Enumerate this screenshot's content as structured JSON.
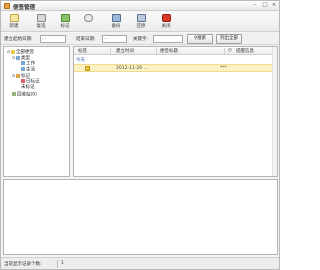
{
  "window": {
    "title": "便签管理"
  },
  "toolbar": {
    "new_label": "新建",
    "delete_label": "复选",
    "mark_label": "标记",
    "search_label": "",
    "backup_label": "备份",
    "restore_label": "还原",
    "close_label": "关闭"
  },
  "filter": {
    "start_date_label": "建立起始日期:",
    "start_date_value": "- -",
    "end_date_label": "结束日期:",
    "end_date_value": "- -",
    "keyword_label": "关键字:",
    "keyword_value": "",
    "search_button": "搜索",
    "list_all_button": "列出全部"
  },
  "tree": {
    "root": "全部便签",
    "category": "类型",
    "work": "工作",
    "life": "生活",
    "mark": "标记",
    "marked": "已标记",
    "unmarked": "未标记",
    "recycle": "回收站(0)"
  },
  "grid": {
    "columns": [
      "标签",
      "建立时间",
      "便签标题",
      "提醒信息"
    ],
    "group_label": "今天",
    "rows": [
      {
        "created": "2012-11-26 ...",
        "title": "",
        "reminder": "***"
      }
    ]
  },
  "status": {
    "text": "当前显示记录个数:",
    "count": "1"
  },
  "colors": {
    "selected_row": "#fdf2c4",
    "group_text": "#2a5db0"
  }
}
